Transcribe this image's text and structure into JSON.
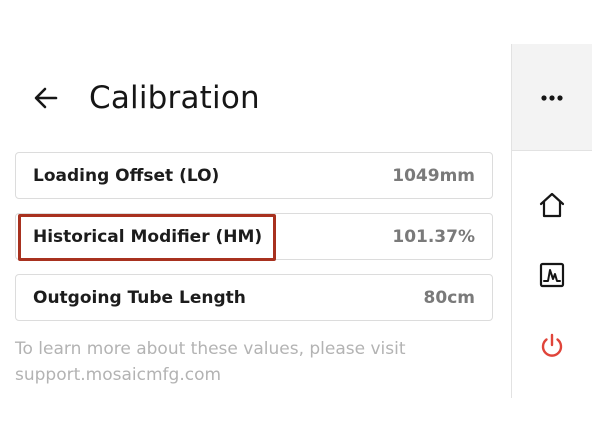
{
  "header": {
    "title": "Calibration",
    "back_icon": "arrow-left-icon"
  },
  "settings": [
    {
      "label": "Loading Offset (LO)",
      "value": "1049mm"
    },
    {
      "label": "Historical Modifier (HM)",
      "value": "101.37%"
    },
    {
      "label": "Outgoing Tube Length",
      "value": "80cm"
    }
  ],
  "help": {
    "line1": "To learn more about these values, please visit",
    "line2": "support.mosaicmfg.com"
  },
  "rail": {
    "items": [
      {
        "icon": "more-horizontal-icon"
      },
      {
        "icon": "home-icon"
      },
      {
        "icon": "chart-icon"
      },
      {
        "icon": "power-icon"
      }
    ]
  },
  "colors": {
    "highlight": "#a8311f",
    "power": "#e0443a",
    "value_text": "#7a7a7a",
    "help_text": "#b3b3b3"
  }
}
